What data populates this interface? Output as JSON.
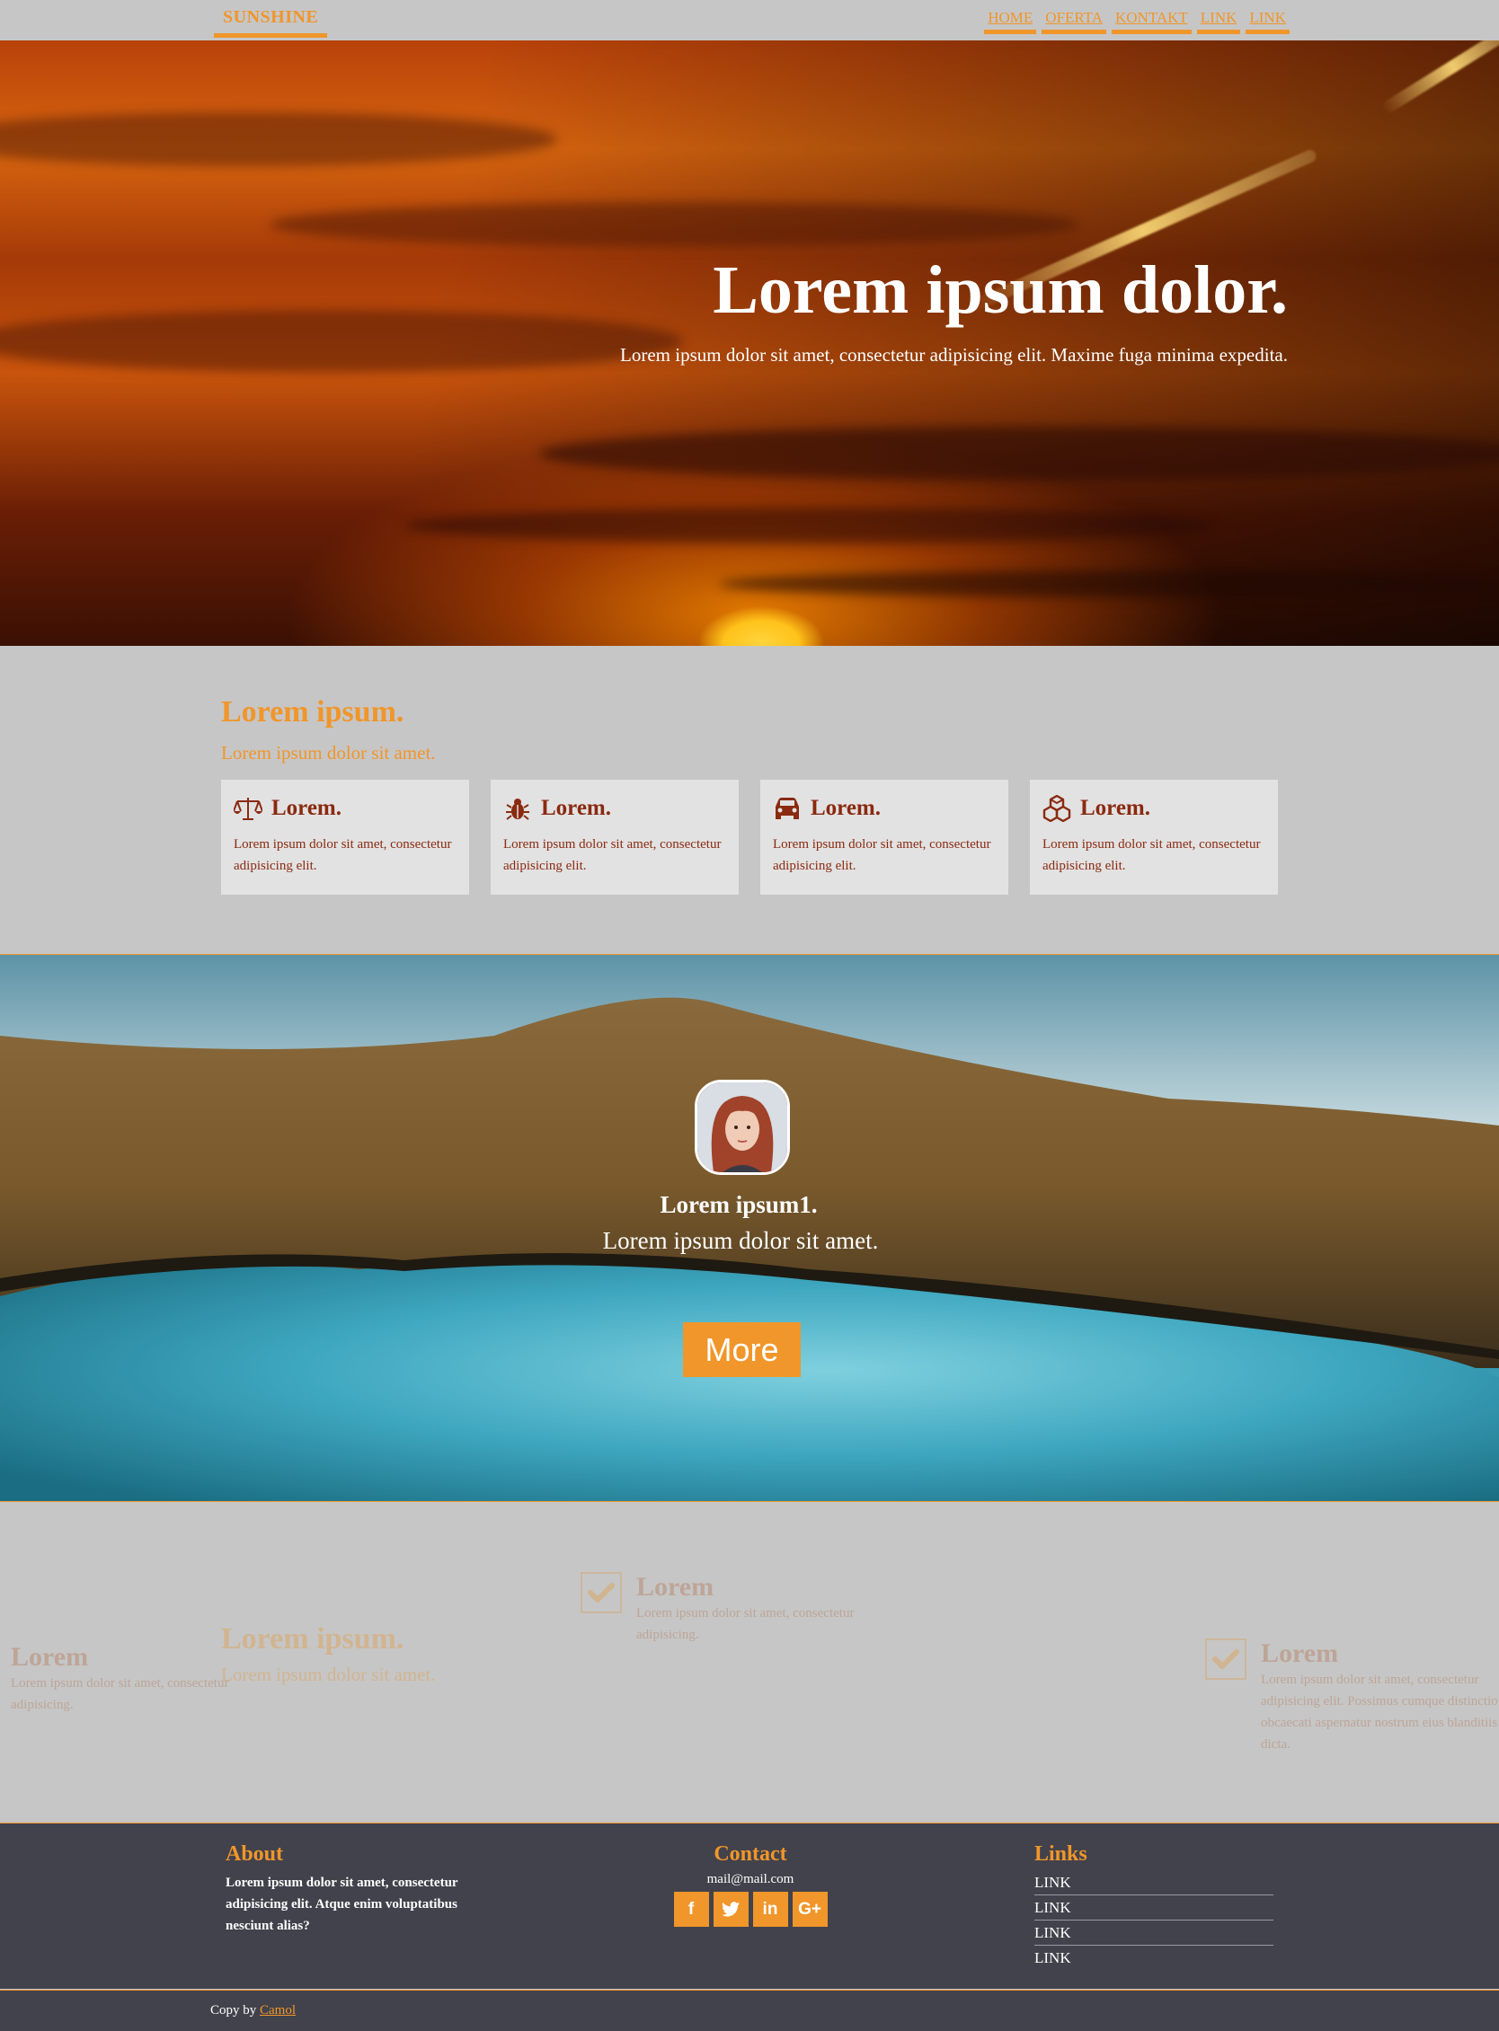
{
  "nav": {
    "brand": "SUNSHINE",
    "links": [
      "HOME",
      "OFERTA",
      "KONTAKT",
      "LINK",
      "LINK"
    ]
  },
  "hero": {
    "title": "Lorem ipsum dolor.",
    "subtitle": "Lorem ipsum dolor sit amet, consectetur adipisicing elit. Maxime fuga minima expedita."
  },
  "features": {
    "title": "Lorem ipsum.",
    "subtitle": "Lorem ipsum dolor sit amet.",
    "cards": [
      {
        "icon": "balance-scale-icon",
        "title": "Lorem.",
        "text": "Lorem ipsum dolor sit amet, consectetur adipisicing elit."
      },
      {
        "icon": "bug-icon",
        "title": "Lorem.",
        "text": "Lorem ipsum dolor sit amet, consectetur adipisicing elit."
      },
      {
        "icon": "car-icon",
        "title": "Lorem.",
        "text": "Lorem ipsum dolor sit amet, consectetur adipisicing elit."
      },
      {
        "icon": "cubes-icon",
        "title": "Lorem.",
        "text": "Lorem ipsum dolor sit amet, consectetur adipisicing elit."
      }
    ]
  },
  "testimonial": {
    "name": "Lorem ipsum1.",
    "text": "Lorem ipsum dolor sit amet.",
    "button": "More"
  },
  "faded": {
    "center_title": "Lorem ipsum.",
    "center_sub": "Lorem ipsum dolor sit amet.",
    "left": {
      "title": "Lorem",
      "text": "Lorem ipsum dolor sit amet, consectetur adipisicing."
    },
    "mid": {
      "title": "Lorem",
      "text": "Lorem ipsum dolor sit amet, consectetur adipisicing."
    },
    "right": {
      "title": "Lorem",
      "text": "Lorem ipsum dolor sit amet, consectetur adipisicing elit. Possimus cumque distinctio obcaecati aspernatur nostrum eius blanditiis dicta."
    }
  },
  "footer": {
    "about_title": "About",
    "about_text": "Lorem ipsum dolor sit amet, consectetur adipisicing elit. Atque enim voluptatibus nesciunt alias?",
    "contact_title": "Contact",
    "contact_mail": "mail@mail.com",
    "socials": [
      {
        "icon": "facebook-icon",
        "glyph": "f"
      },
      {
        "icon": "twitter-icon",
        "glyph": "t"
      },
      {
        "icon": "linkedin-icon",
        "glyph": "in"
      },
      {
        "icon": "google-plus-icon",
        "glyph": "G+"
      }
    ],
    "links_title": "Links",
    "links": [
      "LINK",
      "LINK",
      "LINK",
      "LINK"
    ]
  },
  "copyright": {
    "prefix": "Copy by",
    "author": "Camol"
  },
  "colors": {
    "accent": "#f0962a",
    "card_text": "#8a2a10",
    "footer_bg": "#42424c",
    "page_bg": "#c6c6c6"
  }
}
